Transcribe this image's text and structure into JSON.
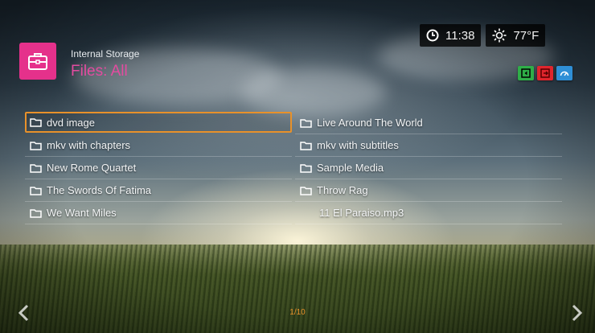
{
  "header": {
    "subtitle": "Internal Storage",
    "title": "Files: All",
    "icon": "briefcase-icon"
  },
  "status": {
    "time": "11:38",
    "temperature": "77°F",
    "clock_icon": "clock-icon",
    "weather_icon": "sun-icon"
  },
  "color_keys": [
    {
      "name": "green-key",
      "color": "#2fae48"
    },
    {
      "name": "red-key",
      "color": "#e0252d"
    },
    {
      "name": "blue-key",
      "color": "#2f8fd6"
    }
  ],
  "files": {
    "left": [
      {
        "label": "dvd image",
        "type": "folder",
        "selected": true
      },
      {
        "label": "mkv with chapters",
        "type": "folder"
      },
      {
        "label": "New Rome Quartet",
        "type": "folder"
      },
      {
        "label": "The Swords Of Fatima",
        "type": "folder"
      },
      {
        "label": "We Want Miles",
        "type": "folder"
      }
    ],
    "right": [
      {
        "label": "Live Around The World",
        "type": "folder"
      },
      {
        "label": "mkv with subtitles",
        "type": "folder"
      },
      {
        "label": "Sample Media",
        "type": "folder"
      },
      {
        "label": "Throw Rag",
        "type": "folder"
      },
      {
        "label": "11 El Paraiso.mp3",
        "type": "file"
      }
    ]
  },
  "pager": {
    "text": "1/10"
  },
  "accent_color": "#e8912a",
  "title_color": "#e34ca0"
}
